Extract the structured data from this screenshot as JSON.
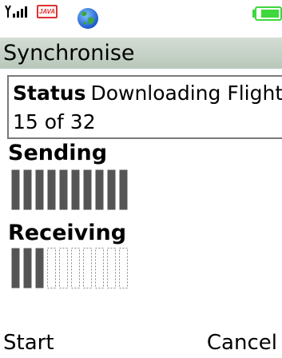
{
  "status_bar": {
    "signal_glyph": "Y.ıll",
    "java_badge": "JAVA",
    "icons": [
      "signal-icon",
      "java-icon",
      "globe-icon",
      "battery-icon"
    ],
    "battery_level": 0.85,
    "battery_color": "#3cd83c"
  },
  "screen": {
    "title": "Synchronise",
    "title_bar_color": "#b8c7ba"
  },
  "status": {
    "label": "Status",
    "text": "Downloading Flight 15 of 32"
  },
  "sending": {
    "label": "Sending",
    "segments_total": 10,
    "segments_filled": 10,
    "fill_color": "#555555"
  },
  "receiving": {
    "label": "Receiving",
    "segments_total": 10,
    "segments_filled": 3,
    "fill_color": "#555555",
    "empty_outline_color": "#8a8a8a"
  },
  "softkeys": {
    "left": "Start",
    "right": "Cancel"
  }
}
